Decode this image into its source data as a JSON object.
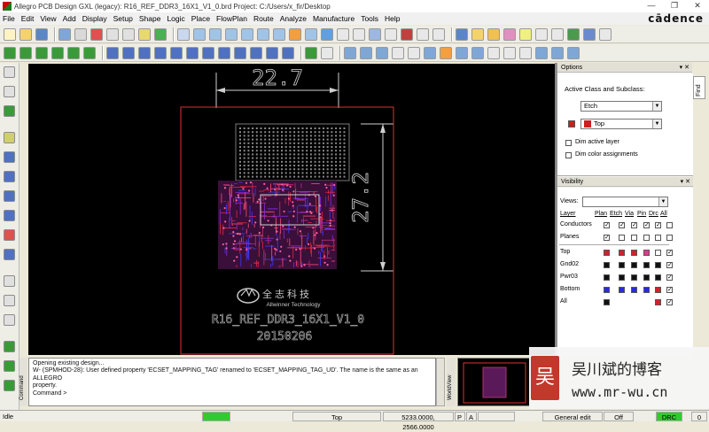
{
  "window": {
    "title": "Allegro PCB Design GXL (legacy): R16_REF_DDR3_16X1_V1_0.brd  Project: C:/Users/x_fir/Desktop",
    "buttons": [
      "—",
      "❐",
      "✕"
    ]
  },
  "menubar": {
    "items": [
      "File",
      "Edit",
      "View",
      "Add",
      "Display",
      "Setup",
      "Shape",
      "Logic",
      "Place",
      "FlowPlan",
      "Route",
      "Analyze",
      "Manufacture",
      "Tools",
      "Help"
    ],
    "brand": "cādence"
  },
  "board": {
    "dim_width": "22.7",
    "dim_height": "27.2",
    "logo_cn": "全志科技",
    "logo_en": "Allwinner Technology",
    "name_text": "R16_REF_DDR3_16X1_V1_0",
    "date_text": "20150206",
    "colors": {
      "background": "#000000",
      "outline": "#ff3030",
      "top_etch": "#e8253c",
      "bottom_etch": "#3b3bff",
      "silk": "#d0d0d0"
    }
  },
  "console": {
    "label": "Command",
    "lines": [
      "Opening existing design...",
      "W- (SPMHOD-28): User defined property 'ECSET_MAPPING_TAG' renamed to 'ECSET_MAPPING_TAG_UD'.  The name is the same as an ALLEGRO",
      "property.",
      "Command >"
    ]
  },
  "worldview": {
    "label": "WorldView"
  },
  "options": {
    "header": "Options",
    "active_label": "Active Class and Subclass:",
    "class_value": "Etch",
    "subclass_value": "Top",
    "subclass_color": "#cc1f1f",
    "dim_active": "Dim active layer",
    "dim_color": "Dim color assignments"
  },
  "find_tab": "Find",
  "visibility": {
    "header": "Visibility",
    "views_label": "Views:",
    "views_value": "",
    "columns": [
      "Layer",
      "Plan",
      "Etch",
      "Via",
      "Pin",
      "Drc",
      "All"
    ],
    "rows_checks": [
      {
        "name": "Conductors",
        "checks": [
          true,
          true,
          true,
          true,
          true,
          false
        ]
      },
      {
        "name": "Planes",
        "checks": [
          true,
          false,
          false,
          false,
          false,
          false
        ]
      }
    ],
    "layers": [
      {
        "name": "Top",
        "colors": [
          "#d61f2c",
          "#d61f2c",
          "#d61f2c",
          "#e03a8f",
          "#ffffff"
        ],
        "all": true
      },
      {
        "name": "Gnd02",
        "colors": [
          "#111111",
          "#111111",
          "#111111",
          "#111111",
          "#111111"
        ],
        "all": true
      },
      {
        "name": "Pwr03",
        "colors": [
          "#111111",
          "#111111",
          "#111111",
          "#111111",
          "#111111"
        ],
        "all": true
      },
      {
        "name": "Bottom",
        "colors": [
          "#2a2ae0",
          "#2a2ae0",
          "#2a2ae0",
          "#2a2ae0",
          "#d61f2c"
        ],
        "all": true
      },
      {
        "name": "All",
        "colors": [
          "#111111",
          "",
          "",
          "",
          "#d61f2c"
        ],
        "all": true
      }
    ]
  },
  "watermark": {
    "name": "吴川斌的博客",
    "url": "www.mr-wu.cn",
    "logo": "吴"
  },
  "status": {
    "left": "Idle",
    "layer": "Top",
    "coords": "5233.0000, 2566.0000",
    "p": "P",
    "a": "A",
    "mode": "General edit",
    "off": "Off",
    "drc": "DRC",
    "zero": "0"
  }
}
